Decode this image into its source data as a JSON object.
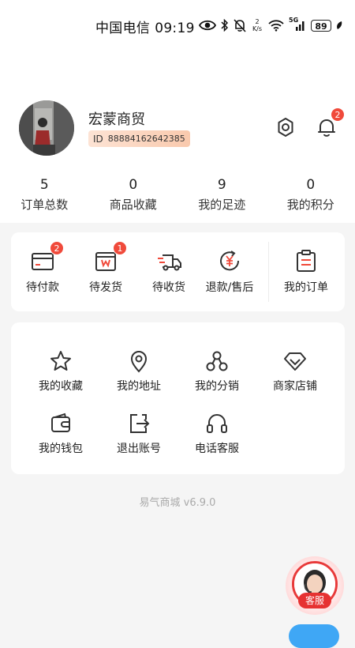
{
  "status_bar": {
    "carrier": "中国电信",
    "time": "09:19",
    "net_speed_value": "2",
    "net_speed_unit": "K/s",
    "signal_label": "5G",
    "battery": "89"
  },
  "profile": {
    "name": "宏蒙商贸",
    "id_label": "ID",
    "id_value": "88884162642385",
    "notification_count": "2"
  },
  "stats": [
    {
      "value": "5",
      "label": "订单总数"
    },
    {
      "value": "0",
      "label": "商品收藏"
    },
    {
      "value": "9",
      "label": "我的足迹"
    },
    {
      "value": "0",
      "label": "我的积分"
    }
  ],
  "orders": [
    {
      "label": "待付款",
      "badge": "2",
      "icon": "wallet-card-icon"
    },
    {
      "label": "待发货",
      "badge": "1",
      "icon": "package-box-icon"
    },
    {
      "label": "待收货",
      "icon": "delivery-truck-icon"
    },
    {
      "label": "退款/售后",
      "icon": "refund-yen-icon"
    },
    {
      "label": "我的订单",
      "icon": "order-clipboard-icon"
    }
  ],
  "services": [
    {
      "label": "我的收藏",
      "icon": "star-icon"
    },
    {
      "label": "我的地址",
      "icon": "location-pin-icon"
    },
    {
      "label": "我的分销",
      "icon": "distribution-network-icon"
    },
    {
      "label": "商家店铺",
      "icon": "diamond-shop-icon"
    },
    {
      "label": "我的钱包",
      "icon": "wallet-icon"
    },
    {
      "label": "退出账号",
      "icon": "logout-icon"
    },
    {
      "label": "电话客服",
      "icon": "headset-icon"
    }
  ],
  "footer": {
    "version_text": "易气商城 v6.9.0"
  },
  "customer_service": {
    "label": "客服"
  },
  "colors": {
    "accent_red": "#f04a3b",
    "icon_stroke": "#333333",
    "background": "#f5f5f5"
  }
}
